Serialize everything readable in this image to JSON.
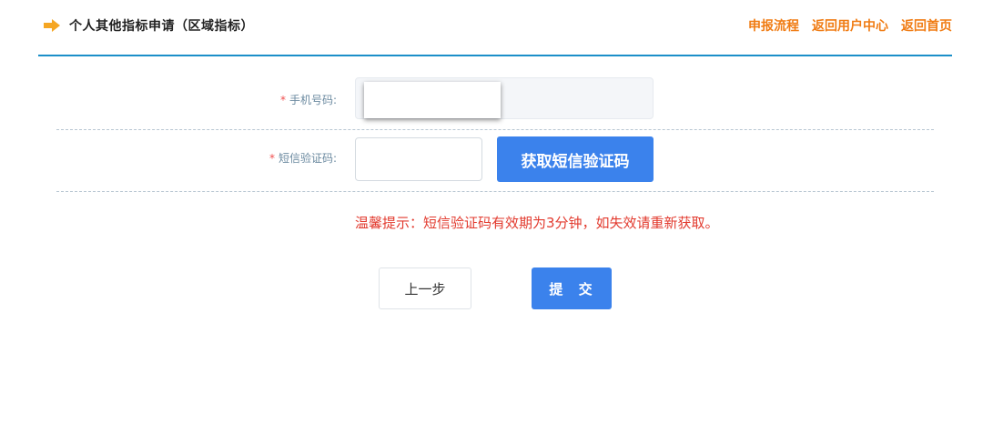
{
  "header": {
    "title": "个人其他指标申请（区域指标）",
    "title_icon": "arrow-right-icon",
    "links": [
      {
        "label": "申报流程"
      },
      {
        "label": "返回用户中心"
      },
      {
        "label": "返回首页"
      }
    ]
  },
  "form": {
    "phone": {
      "required_mark": "*",
      "label": "手机号码:",
      "value": ""
    },
    "sms": {
      "required_mark": "*",
      "label": "短信验证码:",
      "value": "",
      "button_label": "获取短信验证码"
    }
  },
  "tip": "温馨提示：短信验证码有效期为3分钟，如失效请重新获取。",
  "actions": {
    "prev_label": "上一步",
    "submit_label": "提 交"
  },
  "colors": {
    "accent_blue": "#3b82ec",
    "link_orange": "#f07c14",
    "divider_blue": "#1b8fc9",
    "tip_red": "#e23a2e"
  }
}
